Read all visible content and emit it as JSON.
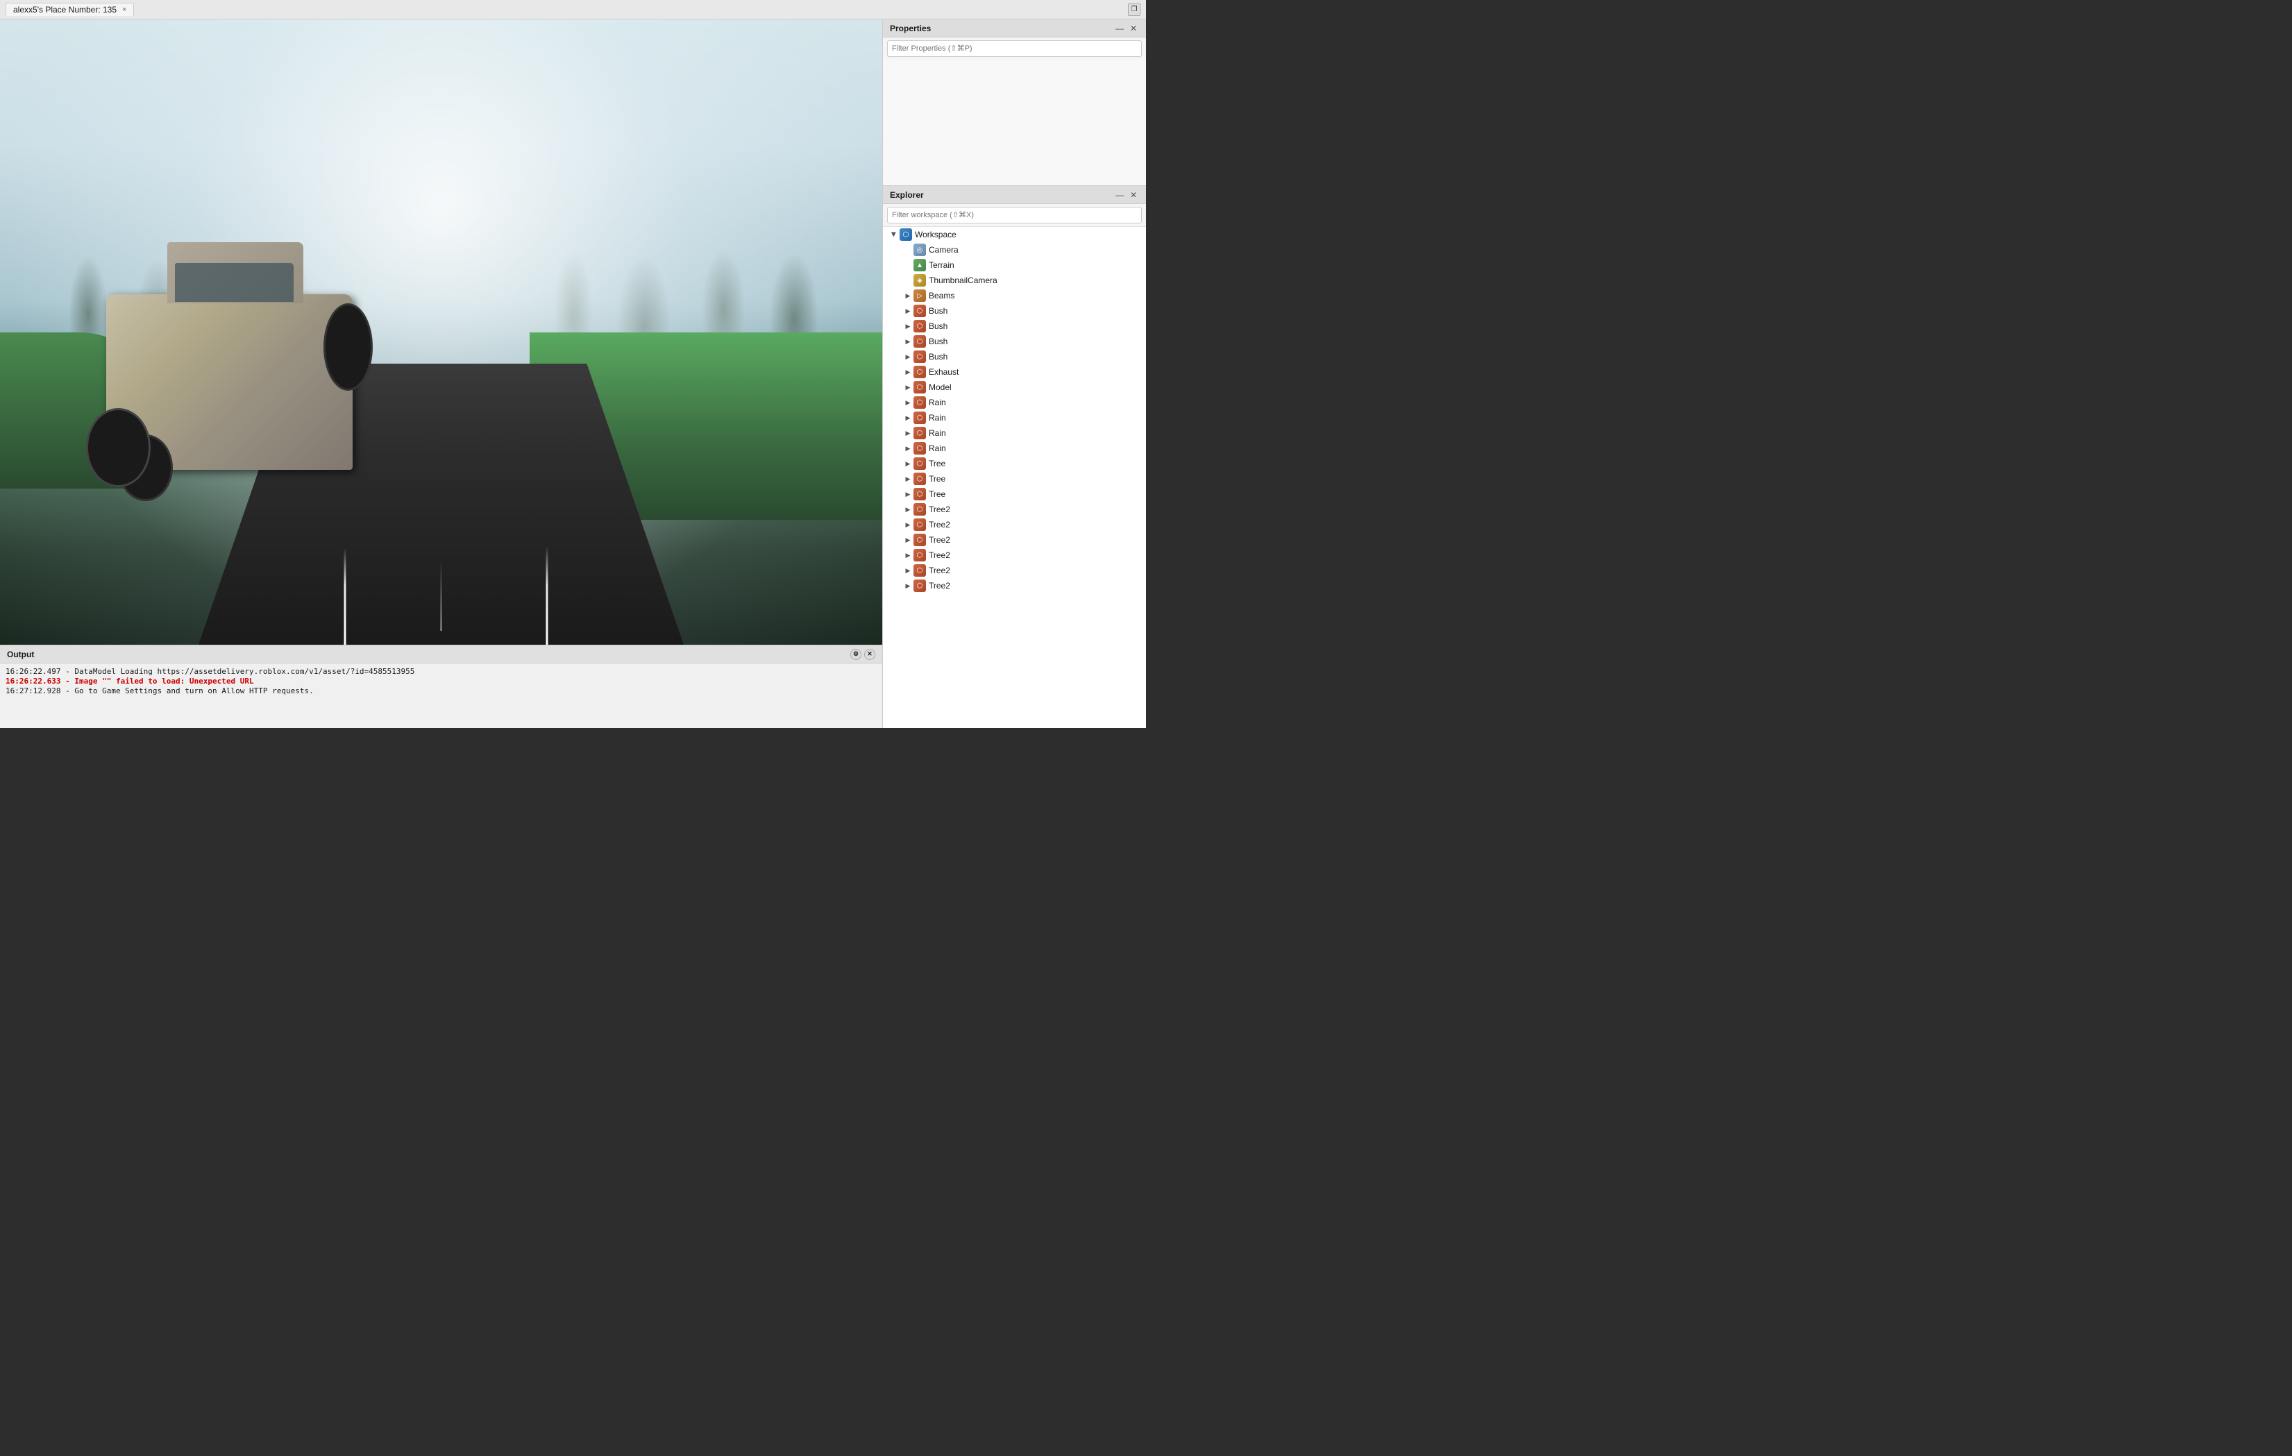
{
  "titlebar": {
    "tab_label": "alexx5's Place Number: 135",
    "close_label": "×",
    "maximize_icon": "⬜"
  },
  "properties_panel": {
    "title": "Properties",
    "filter_placeholder": "Filter Properties (⇧⌘P)",
    "close_icon": "✕",
    "minimize_icon": "—"
  },
  "explorer_panel": {
    "title": "Explorer",
    "filter_placeholder": "Filter workspace (⇧⌘X)",
    "close_icon": "✕",
    "minimize_icon": "—",
    "tree": [
      {
        "id": "workspace",
        "label": "Workspace",
        "icon": "workspace",
        "indent": 0,
        "expanded": true,
        "has_children": true
      },
      {
        "id": "camera",
        "label": "Camera",
        "icon": "camera",
        "indent": 1,
        "expanded": false,
        "has_children": false
      },
      {
        "id": "terrain",
        "label": "Terrain",
        "icon": "terrain",
        "indent": 1,
        "expanded": false,
        "has_children": false
      },
      {
        "id": "thumbnailcamera",
        "label": "ThumbnailCamera",
        "icon": "thumbnail",
        "indent": 1,
        "expanded": false,
        "has_children": false
      },
      {
        "id": "beams",
        "label": "Beams",
        "icon": "folder",
        "indent": 1,
        "expanded": false,
        "has_children": true
      },
      {
        "id": "bush1",
        "label": "Bush",
        "icon": "model",
        "indent": 1,
        "expanded": false,
        "has_children": true
      },
      {
        "id": "bush2",
        "label": "Bush",
        "icon": "model",
        "indent": 1,
        "expanded": false,
        "has_children": true
      },
      {
        "id": "bush3",
        "label": "Bush",
        "icon": "model",
        "indent": 1,
        "expanded": false,
        "has_children": true
      },
      {
        "id": "bush4",
        "label": "Bush",
        "icon": "model",
        "indent": 1,
        "expanded": false,
        "has_children": true
      },
      {
        "id": "exhaust",
        "label": "Exhaust",
        "icon": "model",
        "indent": 1,
        "expanded": false,
        "has_children": true
      },
      {
        "id": "model",
        "label": "Model",
        "icon": "model",
        "indent": 1,
        "expanded": false,
        "has_children": true
      },
      {
        "id": "rain1",
        "label": "Rain",
        "icon": "model",
        "indent": 1,
        "expanded": false,
        "has_children": true
      },
      {
        "id": "rain2",
        "label": "Rain",
        "icon": "model",
        "indent": 1,
        "expanded": false,
        "has_children": true
      },
      {
        "id": "rain3",
        "label": "Rain",
        "icon": "model",
        "indent": 1,
        "expanded": false,
        "has_children": true
      },
      {
        "id": "rain4",
        "label": "Rain",
        "icon": "model",
        "indent": 1,
        "expanded": false,
        "has_children": true
      },
      {
        "id": "tree1",
        "label": "Tree",
        "icon": "model",
        "indent": 1,
        "expanded": false,
        "has_children": true
      },
      {
        "id": "tree2",
        "label": "Tree",
        "icon": "model",
        "indent": 1,
        "expanded": false,
        "has_children": true
      },
      {
        "id": "tree3",
        "label": "Tree",
        "icon": "model",
        "indent": 1,
        "expanded": false,
        "has_children": true
      },
      {
        "id": "tree21",
        "label": "Tree2",
        "icon": "model",
        "indent": 1,
        "expanded": false,
        "has_children": true
      },
      {
        "id": "tree22",
        "label": "Tree2",
        "icon": "model",
        "indent": 1,
        "expanded": false,
        "has_children": true
      },
      {
        "id": "tree23",
        "label": "Tree2",
        "icon": "model",
        "indent": 1,
        "expanded": false,
        "has_children": true
      },
      {
        "id": "tree24",
        "label": "Tree2",
        "icon": "model",
        "indent": 1,
        "expanded": false,
        "has_children": true
      },
      {
        "id": "tree25",
        "label": "Tree2",
        "icon": "model",
        "indent": 1,
        "expanded": false,
        "has_children": true
      },
      {
        "id": "tree26",
        "label": "Tree2",
        "icon": "model",
        "indent": 1,
        "expanded": false,
        "has_children": true
      }
    ]
  },
  "output_panel": {
    "title": "Output",
    "lines": [
      {
        "type": "normal",
        "text": "16:26:22.497 - DataModel Loading https://assetdelivery.roblox.com/v1/asset/?id=4585513955"
      },
      {
        "type": "error",
        "text": "16:26:22.633 - Image \"\" failed to load: Unexpected URL"
      },
      {
        "type": "info",
        "text": "16:27:12.928 - Go to Game Settings and turn on Allow HTTP requests."
      }
    ]
  },
  "icons": {
    "chevron_right": "▶",
    "close": "✕",
    "minimize": "—",
    "maximize": "❐",
    "workspace_symbol": "W",
    "camera_symbol": "📷",
    "terrain_symbol": "⛰",
    "model_symbol": "⬡",
    "folder_symbol": "📁"
  }
}
